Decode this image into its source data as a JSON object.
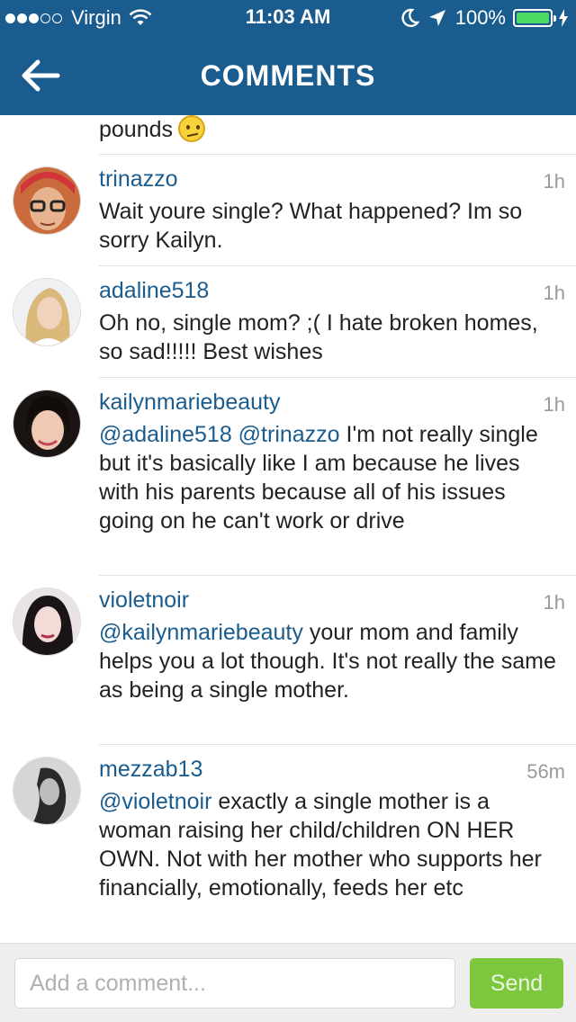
{
  "status_bar": {
    "carrier": "Virgin",
    "time": "11:03 AM",
    "battery": "100%",
    "battery_level": 1.0,
    "signal_bars_filled": 3,
    "signal_bars_total": 5
  },
  "nav": {
    "title": "COMMENTS",
    "back_icon": "back-arrow-icon"
  },
  "partial_comment": {
    "text": "pounds",
    "emoji": "confused-face-emoji"
  },
  "comments": [
    {
      "username": "trinazzo",
      "time": "1h",
      "mentions": "",
      "text": "Wait youre single? What happened? Im so sorry Kailyn."
    },
    {
      "username": "adaline518",
      "time": "1h",
      "mentions": "",
      "text": "Oh no, single mom? ;( I hate broken homes, so sad!!!!! Best wishes"
    },
    {
      "username": "kailynmariebeauty",
      "time": "1h",
      "mentions": "@adaline518 @trinazzo",
      "text": " I'm not really single but it's basically like I am because he lives with his parents because all of his issues going on he can't work or drive"
    },
    {
      "username": "violetnoir",
      "time": "1h",
      "mentions": "@kailynmariebeauty",
      "text": " your mom and family helps you a lot though. It's not really the same as being a single mother."
    },
    {
      "username": "mezzab13",
      "time": "56m",
      "mentions": "@violetnoir",
      "text": " exactly a single mother is a woman raising her child/children ON HER OWN. Not with her mother who supports her financially, emotionally, feeds her etc"
    }
  ],
  "composer": {
    "placeholder": "Add a comment...",
    "value": "",
    "send_label": "Send"
  },
  "colors": {
    "brand_blue": "#1a5c8e",
    "send_green": "#7cc73e",
    "battery_green": "#4cd964"
  }
}
